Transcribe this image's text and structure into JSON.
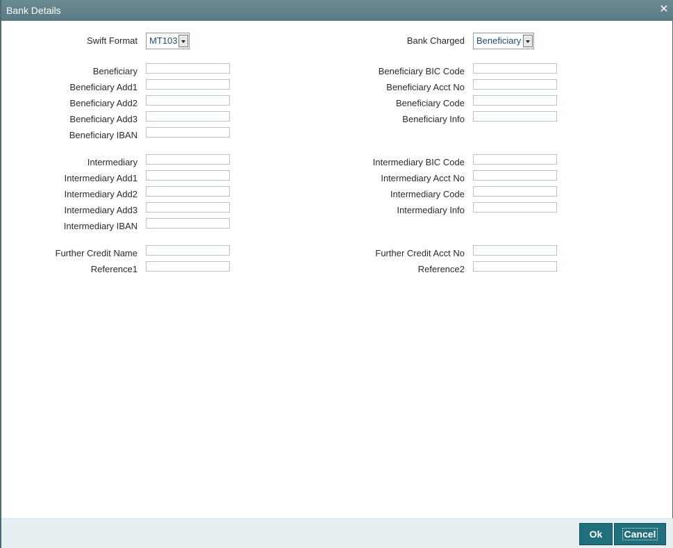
{
  "window": {
    "title": "Bank Details",
    "close_glyph": "✕"
  },
  "swift_format": {
    "label": "Swift Format",
    "value": "MT103"
  },
  "bank_charged": {
    "label": "Bank Charged",
    "value": "Beneficiary"
  },
  "left_fields": [
    {
      "label": "Beneficiary"
    },
    {
      "label": "Beneficiary Add1"
    },
    {
      "label": "Beneficiary Add2"
    },
    {
      "label": "Beneficiary Add3"
    },
    {
      "label": "Beneficiary IBAN"
    },
    {
      "label": "Intermediary"
    },
    {
      "label": "Intermediary Add1"
    },
    {
      "label": "Intermediary Add2"
    },
    {
      "label": "Intermediary Add3"
    },
    {
      "label": "Intermediary IBAN"
    },
    {
      "label": "Further Credit Name"
    },
    {
      "label": "Reference1"
    }
  ],
  "right_fields": [
    {
      "label": "Beneficiary BIC Code"
    },
    {
      "label": "Beneficiary Acct No"
    },
    {
      "label": "Beneficiary Code"
    },
    {
      "label": "Beneficiary Info"
    },
    {
      "label": "Intermediary BIC Code"
    },
    {
      "label": "Intermediary Acct No"
    },
    {
      "label": "Intermediary Code"
    },
    {
      "label": "Intermediary Info"
    },
    {
      "label": "Further Credit Acct No"
    },
    {
      "label": "Reference2"
    }
  ],
  "footer": {
    "ok_label": "Ok",
    "cancel_label": "Cancel"
  }
}
